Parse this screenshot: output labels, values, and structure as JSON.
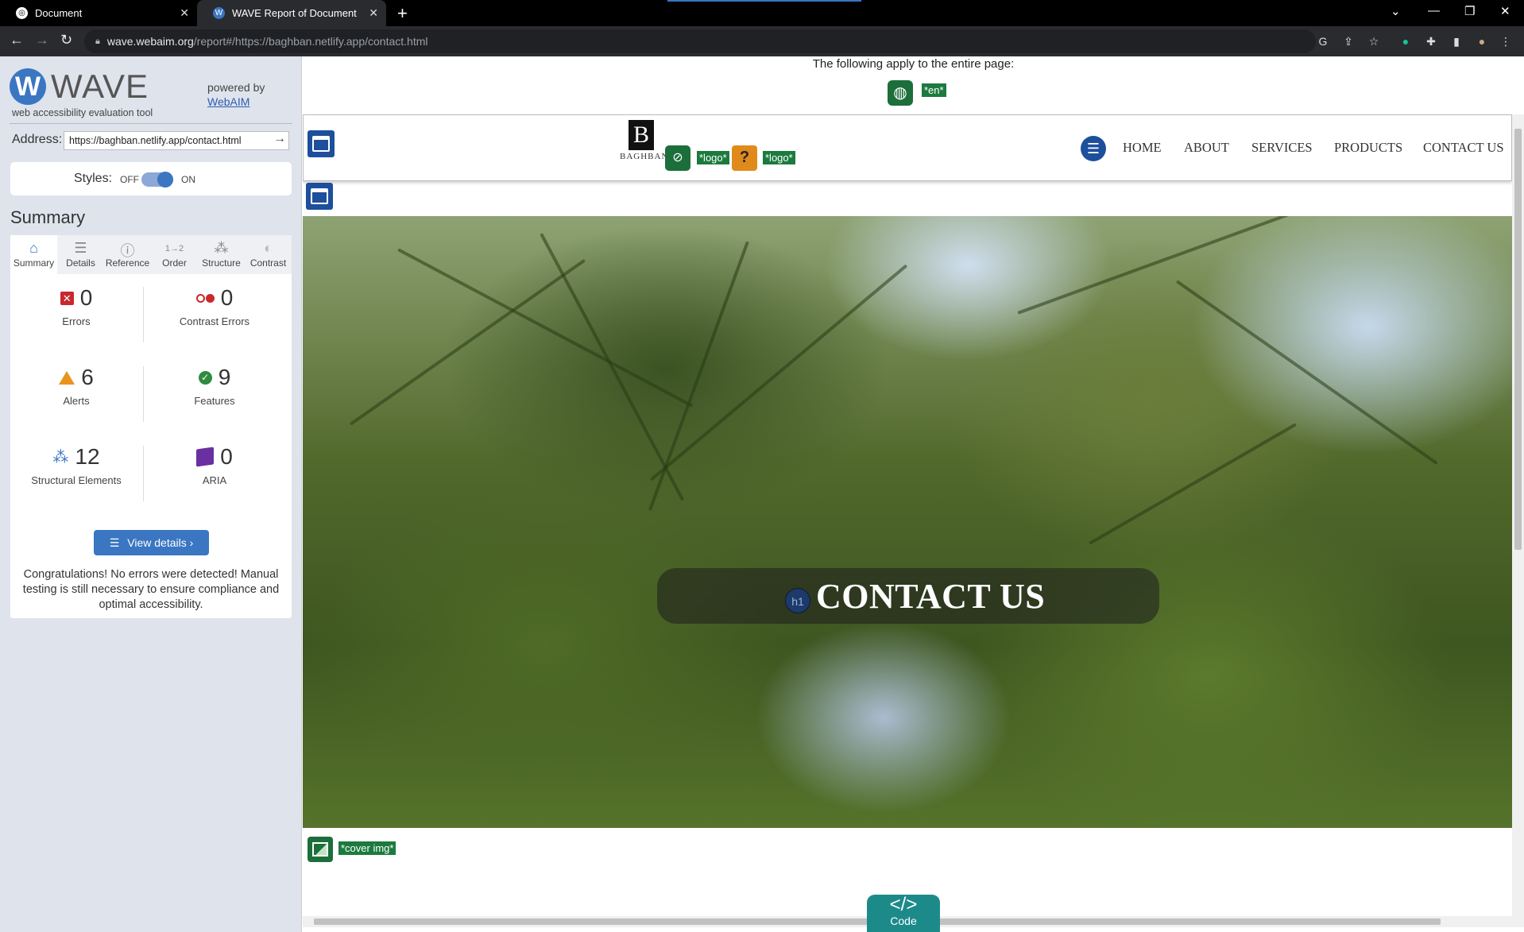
{
  "browser": {
    "tabs": [
      {
        "title": "Document",
        "favicon": "globe-icon"
      },
      {
        "title": "WAVE Report of Document",
        "favicon": "wave-icon"
      }
    ],
    "url_host": "wave.webaim.org",
    "url_path": "/report#/https://baghban.netlify.app/contact.html"
  },
  "wave": {
    "title": "WAVE",
    "subtitle": "web accessibility evaluation tool",
    "powered_by": "powered by",
    "webaim_link": "WebAIM",
    "address_label": "Address:",
    "address_value": "https://baghban.netlify.app/contact.html",
    "styles_label": "Styles:",
    "styles_off": "OFF",
    "styles_on": "ON",
    "styles_enabled": true,
    "summary_heading": "Summary",
    "tabs": [
      "Summary",
      "Details",
      "Reference",
      "Order",
      "Structure",
      "Contrast"
    ],
    "active_tab": "Summary",
    "stats": {
      "errors": {
        "value": "0",
        "label": "Errors"
      },
      "contrast_errors": {
        "value": "0",
        "label": "Contrast Errors"
      },
      "alerts": {
        "value": "6",
        "label": "Alerts"
      },
      "features": {
        "value": "9",
        "label": "Features"
      },
      "structural": {
        "value": "12",
        "label": "Structural Elements"
      },
      "aria": {
        "value": "0",
        "label": "ARIA"
      }
    },
    "view_details": "View details ›",
    "congrats": "Congratulations! No errors were detected! Manual testing is still necessary to ensure compliance and optimal accessibility."
  },
  "preview": {
    "page_note": "The following apply to the entire page:",
    "lang_tag": "*en*",
    "logo_letter": "B",
    "logo_text": "BAGHBAN",
    "logo_tag_1": "*logo*",
    "logo_tag_2": "*logo*",
    "alert_mark": "?",
    "nav": [
      "HOME",
      "ABOUT",
      "SERVICES",
      "PRODUCTS",
      "CONTACT US"
    ],
    "h1_badge": "h1",
    "hero_title": "CONTACT US",
    "cover_tag": "*cover img*",
    "code_tab_symbol": "</>",
    "code_tab_label": "Code"
  },
  "colors": {
    "wave_blue": "#3a76c2",
    "wave_green": "#1c7a3e",
    "error_red": "#c8282e",
    "alert_orange": "#e8941c"
  }
}
